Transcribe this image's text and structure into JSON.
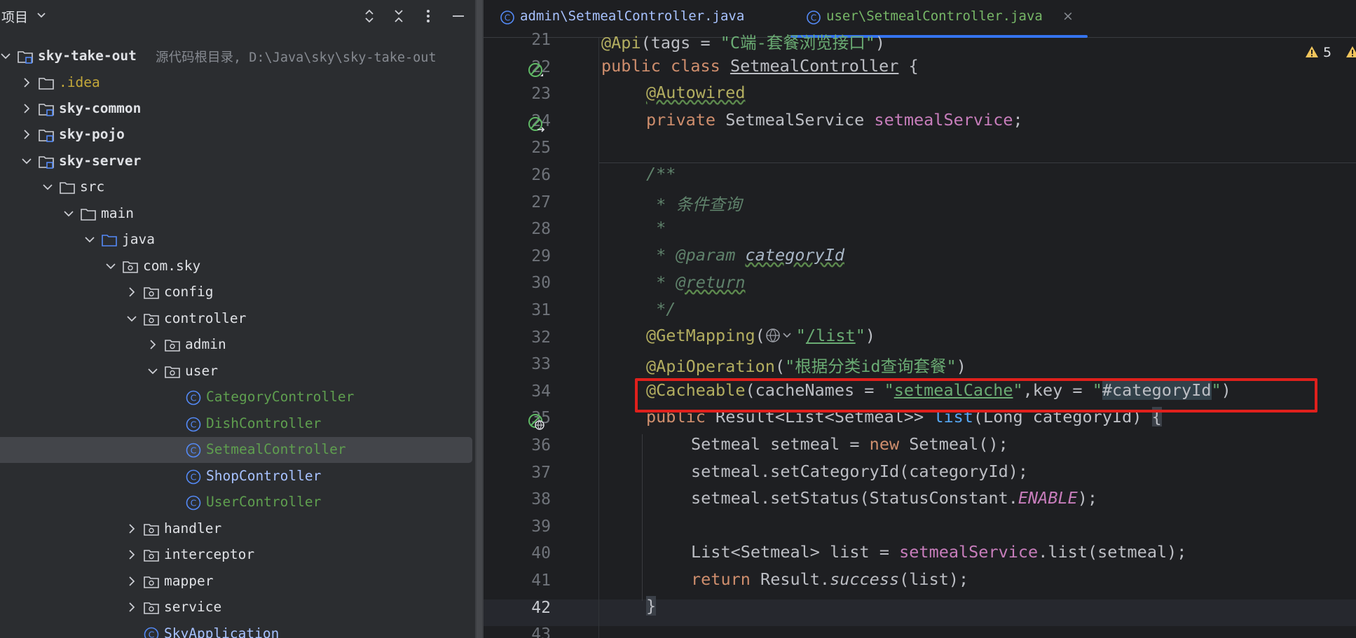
{
  "project_panel": {
    "title": "项目",
    "icons": [
      "chevron-down-icon",
      "expand-icon",
      "collapse-icon",
      "more-icon",
      "minimize-icon"
    ],
    "tree": [
      {
        "label": "sky-take-out",
        "hint": "源代码根目录,  D:\\Java\\sky\\sky-take-out",
        "icon": "module-icon",
        "expanded": true
      },
      {
        "label": ".idea",
        "icon": "folder-icon",
        "expanded": false
      },
      {
        "label": "sky-common",
        "icon": "module-icon",
        "expanded": false
      },
      {
        "label": "sky-pojo",
        "icon": "module-icon",
        "expanded": false
      },
      {
        "label": "sky-server",
        "icon": "module-icon",
        "expanded": true
      },
      {
        "label": "src",
        "icon": "folder-icon",
        "expanded": true
      },
      {
        "label": "main",
        "icon": "folder-icon",
        "expanded": true
      },
      {
        "label": "java",
        "icon": "source-folder-icon",
        "expanded": true
      },
      {
        "label": "com.sky",
        "icon": "package-icon",
        "expanded": true
      },
      {
        "label": "config",
        "icon": "package-icon",
        "expanded": false
      },
      {
        "label": "controller",
        "icon": "package-icon",
        "expanded": true
      },
      {
        "label": "admin",
        "icon": "package-icon",
        "expanded": false
      },
      {
        "label": "user",
        "icon": "package-icon",
        "expanded": true
      },
      {
        "label": "CategoryController",
        "icon": "class-icon"
      },
      {
        "label": "DishController",
        "icon": "class-icon"
      },
      {
        "label": "SetmealController",
        "icon": "class-icon",
        "selected": true
      },
      {
        "label": "ShopController",
        "icon": "class-icon"
      },
      {
        "label": "UserController",
        "icon": "class-icon"
      },
      {
        "label": "handler",
        "icon": "package-icon",
        "expanded": false
      },
      {
        "label": "interceptor",
        "icon": "package-icon",
        "expanded": false
      },
      {
        "label": "mapper",
        "icon": "package-icon",
        "expanded": false
      },
      {
        "label": "service",
        "icon": "package-icon",
        "expanded": false
      },
      {
        "label": "SkyApplication",
        "icon": "class-icon"
      }
    ]
  },
  "editor": {
    "tabs": [
      {
        "label": "admin\\SetmealController.java",
        "active": false
      },
      {
        "label": "user\\SetmealController.java",
        "active": true,
        "close": "×"
      }
    ],
    "warning_count": "5",
    "line_numbers": [
      "21",
      "22",
      "23",
      "24",
      "25",
      "26",
      "27",
      "28",
      "29",
      "30",
      "31",
      "32",
      "33",
      "34",
      "35",
      "36",
      "37",
      "38",
      "39",
      "40",
      "41",
      "42",
      "43"
    ],
    "current_line": "42",
    "code": {
      "l21_ann": "@Api",
      "l21_a": "(tags = ",
      "l21_str": "\"C端-套餐浏览接口\"",
      "l21_b": ")",
      "l22_kw": "public class ",
      "l22_name": "SetmealController",
      "l22_rest": " {",
      "l23_ann": "@Autowired",
      "l24_kw": "private ",
      "l24_type": "SetmealService ",
      "l24_field": "setmealService",
      "l24_end": ";",
      "l26": "/**",
      "l27": " * 条件查询",
      "l28": " *",
      "l29_star": " * ",
      "l29_tag": "@param",
      "l29_param": "categoryId",
      "l30_star": " * ",
      "l30_tag": "@return",
      "l31": " */",
      "l32_ann": "@GetMapping",
      "l32_open": "(",
      "l32_str_a": "\"",
      "l32_str_b": "/list",
      "l32_str_c": "\"",
      "l32_close": ")",
      "l33_ann": "@ApiOperation",
      "l33_open": "(",
      "l33_str": "\"根据分类id查询套餐\"",
      "l33_close": ")",
      "l34_ann": "@Cacheable",
      "l34_a": "(cacheNames = ",
      "l34_q1": "\"",
      "l34_cache": "setmealCache",
      "l34_q2": "\"",
      "l34_b": ",key = ",
      "l34_q3": "\"",
      "l34_key": "#categoryId",
      "l34_q4": "\"",
      "l34_c": ")",
      "l35_kw": "public ",
      "l35_type": "Result<List<Setmeal>> ",
      "l35_fn": "list",
      "l35_args": "(Long categoryId) ",
      "l35_brace": "{",
      "l36_a": "Setmeal setmeal = ",
      "l36_kw": "new ",
      "l36_b": "Setmeal();",
      "l37": "setmeal.setCategoryId(categoryId);",
      "l38_a": "setmeal.setStatus(StatusConstant.",
      "l38_const": "ENABLE",
      "l38_b": ");",
      "l40_a": "List<Setmeal> list = ",
      "l40_field": "setmealService",
      "l40_b": ".list(setmeal);",
      "l41_kw": "return ",
      "l41_a": "Result.",
      "l41_fn": "success",
      "l41_b": "(list);",
      "l42": "}"
    }
  },
  "colors": {
    "background": "#1e1f22",
    "panel": "#2b2d30",
    "highlight_box": "#e0201c",
    "tab_underline": "#3574f0"
  }
}
